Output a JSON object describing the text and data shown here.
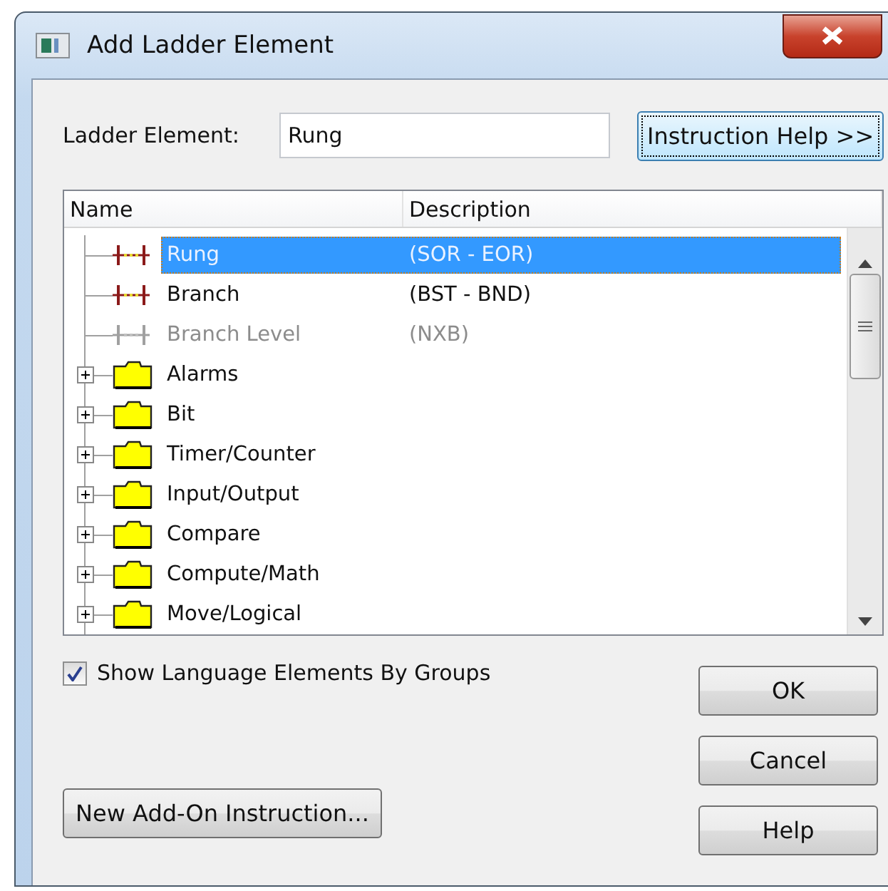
{
  "window": {
    "title": "Add Ladder Element"
  },
  "ladder_element": {
    "label": "Ladder Element:",
    "value": "Rung"
  },
  "instruction_help_button": {
    "label": "Instruction Help >>",
    "focused": true
  },
  "tree": {
    "columns": [
      "Name",
      "Description"
    ],
    "items": [
      {
        "kind": "rung",
        "name": "Rung",
        "description": "(SOR - EOR)",
        "selected": true,
        "disabled": false
      },
      {
        "kind": "branch",
        "name": "Branch",
        "description": "(BST - BND)",
        "selected": false,
        "disabled": false
      },
      {
        "kind": "branch-level",
        "name": "Branch Level",
        "description": "(NXB)",
        "selected": false,
        "disabled": true
      },
      {
        "kind": "folder",
        "name": "Alarms",
        "selected": false,
        "expanded": false
      },
      {
        "kind": "folder",
        "name": "Bit",
        "selected": false,
        "expanded": false
      },
      {
        "kind": "folder",
        "name": "Timer/Counter",
        "selected": false,
        "expanded": false
      },
      {
        "kind": "folder",
        "name": "Input/Output",
        "selected": false,
        "expanded": false
      },
      {
        "kind": "folder",
        "name": "Compare",
        "selected": false,
        "expanded": false
      },
      {
        "kind": "folder",
        "name": "Compute/Math",
        "selected": false,
        "expanded": false
      },
      {
        "kind": "folder",
        "name": "Move/Logical",
        "selected": false,
        "expanded": false
      }
    ]
  },
  "group_checkbox": {
    "label": "Show Language Elements By Groups",
    "checked": true
  },
  "buttons": {
    "ok": "OK",
    "cancel": "Cancel",
    "help": "Help",
    "new_add_on": "New Add-On Instruction..."
  }
}
